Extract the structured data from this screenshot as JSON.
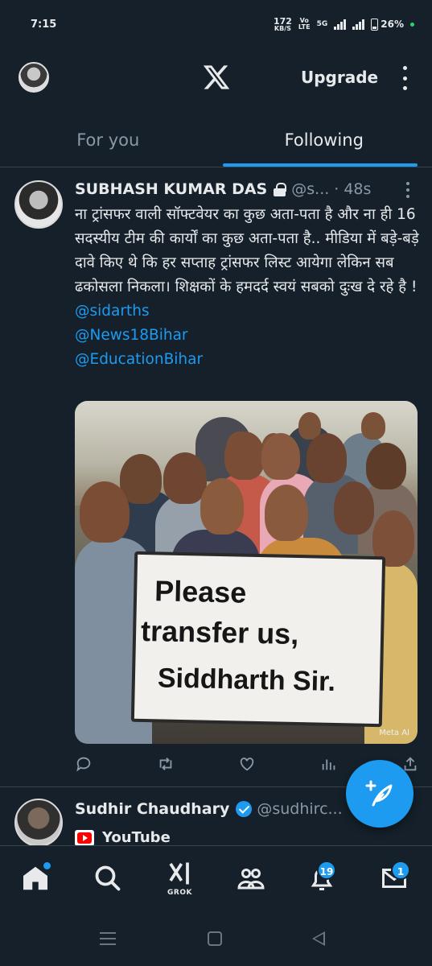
{
  "status_bar": {
    "time": "7:15",
    "net_speed": "172",
    "net_unit": "KB/S",
    "volte_top": "Vo",
    "volte_bottom": "LTE",
    "network": "5G",
    "battery": "26%"
  },
  "header": {
    "logo_icon": "x-logo-icon",
    "upgrade_label": "Upgrade"
  },
  "tabs": [
    {
      "label": "For you",
      "active": false
    },
    {
      "label": "Following",
      "active": true
    }
  ],
  "tweets": [
    {
      "name": "SUBHASH KUMAR DAS",
      "handle": "@s...",
      "separator": "·",
      "time": "48s",
      "text": "ना ट्रांसफर वाली सॉफ्टवेयर का कुछ अता-पता है और ना ही 16 सदस्यीय टीम की कार्यों का कुछ अता-पता है.. मीडिया में बड़े-बड़े दावे किए थे कि हर सप्ताह ट्रांसफर लिस्ट आयेगा लेकिन सब ढकोसला निकला। शिक्षकों के हमदर्द स्वयं सबको दुःख दे रहे है !",
      "mentions": [
        "@sidarths",
        "@News18Bihar",
        "@EducationBihar"
      ],
      "media": {
        "sign_line1": "Please",
        "sign_line2": "transfer us,",
        "sign_line3": "Siddharth Sir.",
        "watermark": "Meta AI"
      }
    },
    {
      "name": "Sudhir Chaudhary",
      "handle": "@sudhirc...",
      "link_label": "YouTube"
    }
  ],
  "bottom_nav": {
    "grok_label": "GROK",
    "notifications_badge": "19",
    "messages_badge": "1"
  },
  "colors": {
    "background": "#15202b",
    "accent": "#1d9bf0",
    "divider": "#38444d",
    "text_secondary": "#8b98a5"
  }
}
